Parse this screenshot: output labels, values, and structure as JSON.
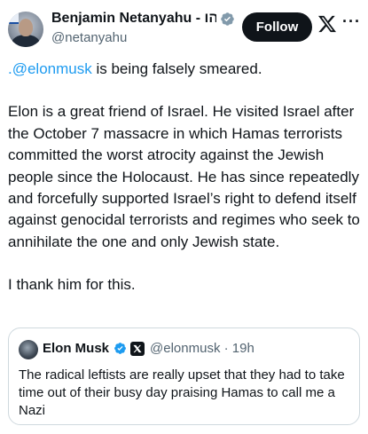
{
  "author": {
    "display_name": "Benjamin Netanyahu - הו...",
    "handle": "@netanyahu",
    "verified_icon": "verified-gray-badge-icon"
  },
  "actions": {
    "follow_label": "Follow",
    "x_logo": "x-logo-icon",
    "more_label": "···"
  },
  "tweet": {
    "mention": ".@elonmusk",
    "line1_rest": " is being falsely smeared.",
    "paragraph2": "Elon is a great friend of Israel.  He visited Israel after the October 7 massacre in which Hamas terrorists committed the worst atrocity against the Jewish people since the Holocaust. He has since repeatedly and forcefully supported Israel’s right to defend itself against genocidal terrorists and regimes who seek to annihilate the one and only Jewish state.",
    "paragraph3": "I thank him for this."
  },
  "quote": {
    "name": "Elon Musk",
    "handle_time": "@elonmusk · 19h",
    "text": "The radical leftists are really upset that they had to take time out of their busy day praising Hamas to call me a Nazi"
  },
  "colors": {
    "link": "#1d9bf0",
    "text": "#0f1419",
    "secondary": "#536471",
    "verified_gold": "#e2b719",
    "verified_blue": "#1d9bf0"
  }
}
